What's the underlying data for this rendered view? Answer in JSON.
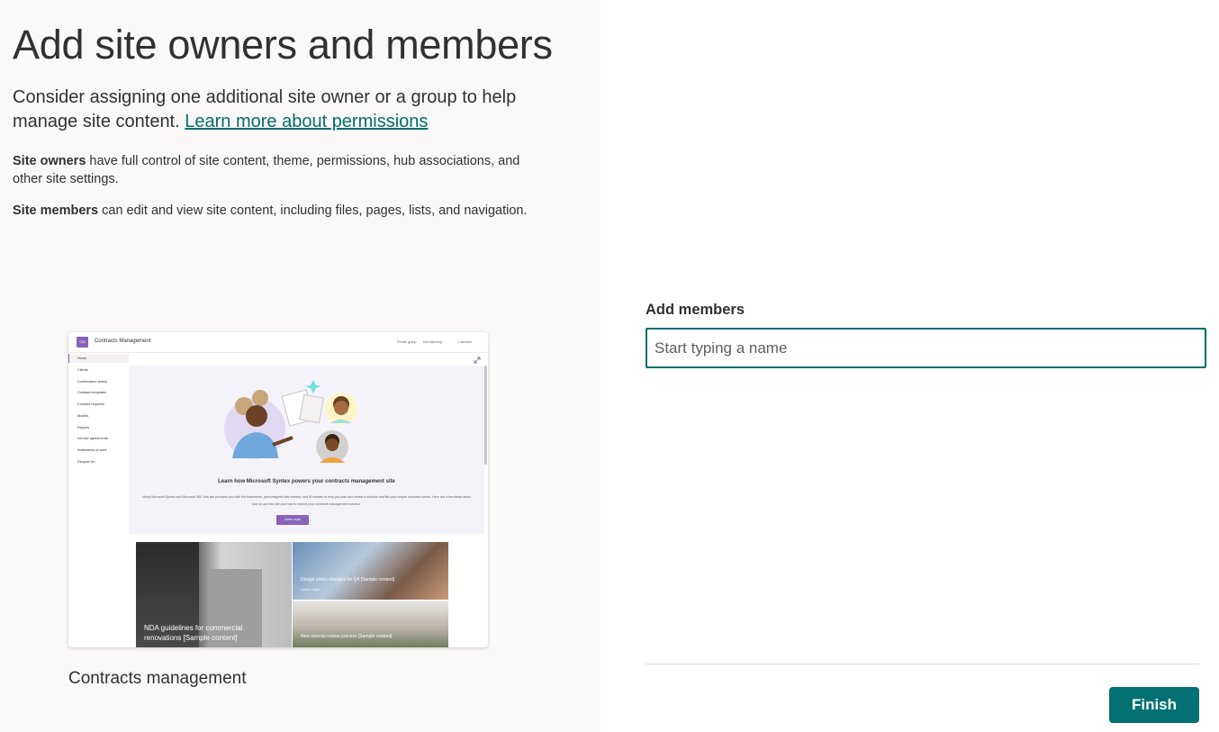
{
  "page": {
    "title": "Add site owners and members",
    "intro_text": "Consider assigning one additional site owner or a group to help manage site content.",
    "learn_more_link": "Learn more about permissions",
    "owners_term": "Site owners",
    "owners_desc": " have full control of site content, theme, permissions, hub associations, and other site settings.",
    "members_term": "Site members",
    "members_desc": " can edit and view site content, including files, pages, lists, and navigation."
  },
  "preview": {
    "logo_text": "CM",
    "site_name": "Contracts Management",
    "meta": [
      "Private group",
      "Not following",
      "1 member"
    ],
    "nav_items": [
      "Home",
      "Clients",
      "Confirmation letters",
      "Contract templates",
      "Contract requests",
      "Models",
      "Reports",
      "Service agreements",
      "Statements of work",
      "Recycle bin"
    ],
    "hero_title": "Learn how Microsoft Syntex powers your contracts management site",
    "hero_text": "Using Microsoft Syntex and Microsoft 365, this site provides you with the framework, preconfigured site content, and AI models to help you plan and create a solution that fits your unique business needs. Here are a few ideas about how to use this site and how to extend your contracts management solution.",
    "hero_button": "Learn more",
    "tiles": [
      {
        "title": "NDA guidelines for commercial renovations [Sample content]"
      },
      {
        "title": "Design policy changes for Q4 [Sample content]",
        "link": "Learn more"
      },
      {
        "title": "New internal review process [Sample content]"
      }
    ],
    "caption": "Contracts management"
  },
  "form": {
    "members_label": "Add members",
    "members_placeholder": "Start typing a name",
    "members_value": ""
  },
  "actions": {
    "finish_label": "Finish"
  },
  "colors": {
    "accent": "#036c70",
    "button": "#037173",
    "preview_accent": "#8764b8",
    "left_panel_bg": "#faf9f8"
  }
}
